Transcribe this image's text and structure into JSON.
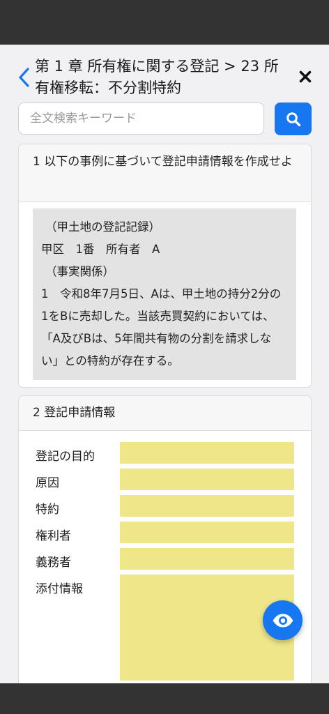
{
  "header": {
    "title": "第 1 章 所有権に関する登記 > 23 所有権移転：不分割特約"
  },
  "search": {
    "placeholder": "全文検索キーワード"
  },
  "section1": {
    "heading": "1 以下の事例に基づいて登記申請情報を作成せよ",
    "record_lines": [
      "（甲土地の登記記録）",
      "甲区　1番　所有者　A",
      "（事実関係）",
      "1　令和8年7月5日、Aは、甲土地の持分2分の1をBに売却した。当該売買契約においては、「A及びBは、5年間共有物の分割を請求しない」との特約が存在する。"
    ]
  },
  "section2": {
    "heading": "2 登記申請情報",
    "fields": [
      {
        "label": "登記の目的",
        "value": ""
      },
      {
        "label": "原因",
        "value": ""
      },
      {
        "label": "特約",
        "value": ""
      },
      {
        "label": "権利者",
        "value": ""
      },
      {
        "label": "義務者",
        "value": ""
      },
      {
        "label": "添付情報",
        "value": ""
      }
    ]
  },
  "colors": {
    "accent": "#1677f0",
    "answer_field": "#efe68a",
    "record_box": "#e3e3e3",
    "system_bar": "#333333"
  },
  "icons": {
    "back": "chevron-left-icon",
    "close": "close-icon",
    "search": "search-icon",
    "reveal": "eye-icon"
  }
}
